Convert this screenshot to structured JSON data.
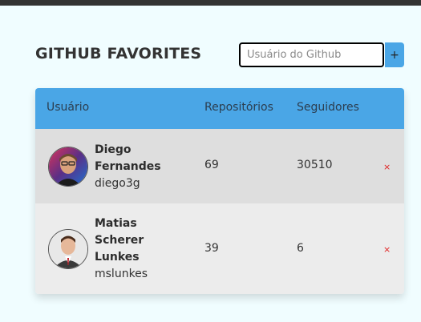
{
  "header": {
    "title": "GITHUB FAVORITES",
    "search_placeholder": "Usuário do Github",
    "add_label": "+"
  },
  "table": {
    "columns": [
      "Usuário",
      "Repositórios",
      "Seguidores"
    ],
    "rows": [
      {
        "name": "Diego Fernandes",
        "login": "diego3g",
        "repos": "69",
        "followers": "30510",
        "remove": "×"
      },
      {
        "name": "Matias Scherer Lunkes",
        "login": "mslunkes",
        "repos": "39",
        "followers": "6",
        "remove": "×"
      }
    ]
  },
  "colors": {
    "header": "#4aa6e6",
    "background": "#f0fdff",
    "remove": "#e02020"
  }
}
